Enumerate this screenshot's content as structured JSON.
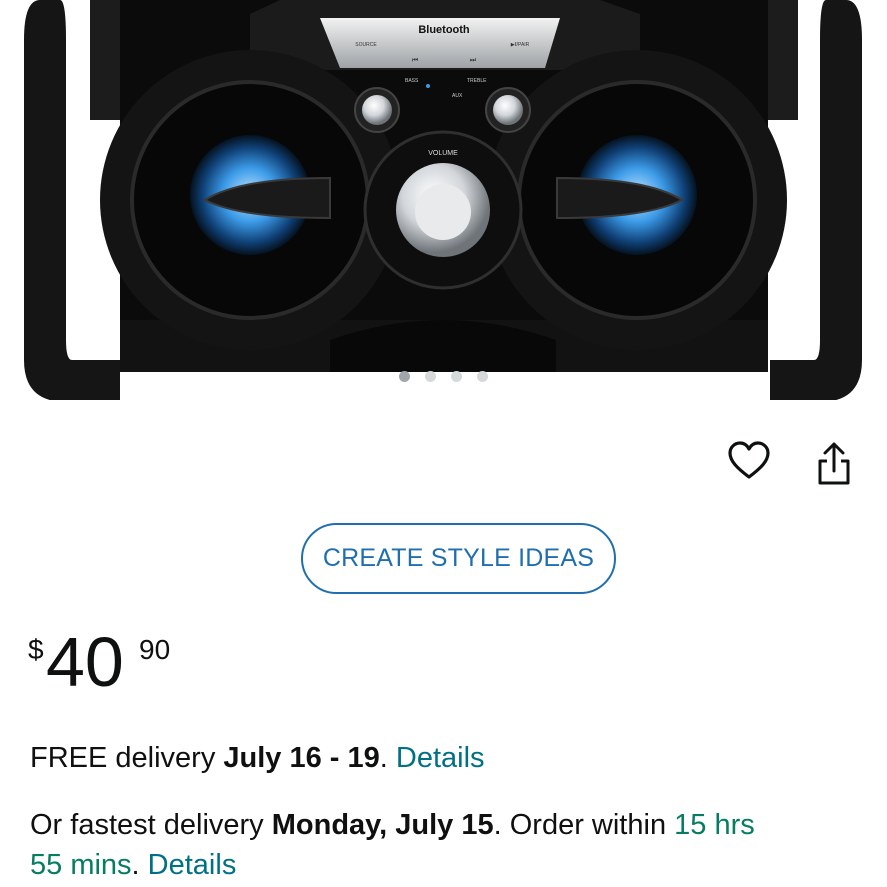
{
  "image": {
    "brand_label": "Bluetooth",
    "knob_volume_label": "VOLUME",
    "btn_source": "SOURCE",
    "btn_pair": "▶‖/PAIR",
    "btn_prev": "⏮",
    "btn_next": "⏭",
    "label_bass": "BASS",
    "label_treble": "TREBLE",
    "label_aux": "AUX",
    "carousel": {
      "count": 4,
      "active_index": 0
    }
  },
  "actions": {
    "favorite_icon": "heart-icon",
    "share_icon": "share-icon"
  },
  "style_ideas": {
    "label": "CREATE STYLE IDEAS"
  },
  "price": {
    "symbol": "$",
    "whole": "40",
    "fraction": "90"
  },
  "delivery": {
    "free_prefix": "FREE delivery ",
    "free_dates": "July 16 - 19",
    "free_sep": ". ",
    "free_details": "Details",
    "fast_prefix": "Or fastest delivery ",
    "fast_date": "Monday, July 15",
    "fast_mid": ". Order within ",
    "fast_countdown_1": "15 hrs",
    "fast_countdown_2": "55 mins",
    "fast_sep": ". ",
    "fast_details": "Details"
  },
  "colors": {
    "link": "#007185",
    "accent_blue": "#1f6fb0",
    "countdown_green": "#067d62",
    "dot_active": "#a2a6ac",
    "dot_inactive": "#d5d9d9"
  }
}
